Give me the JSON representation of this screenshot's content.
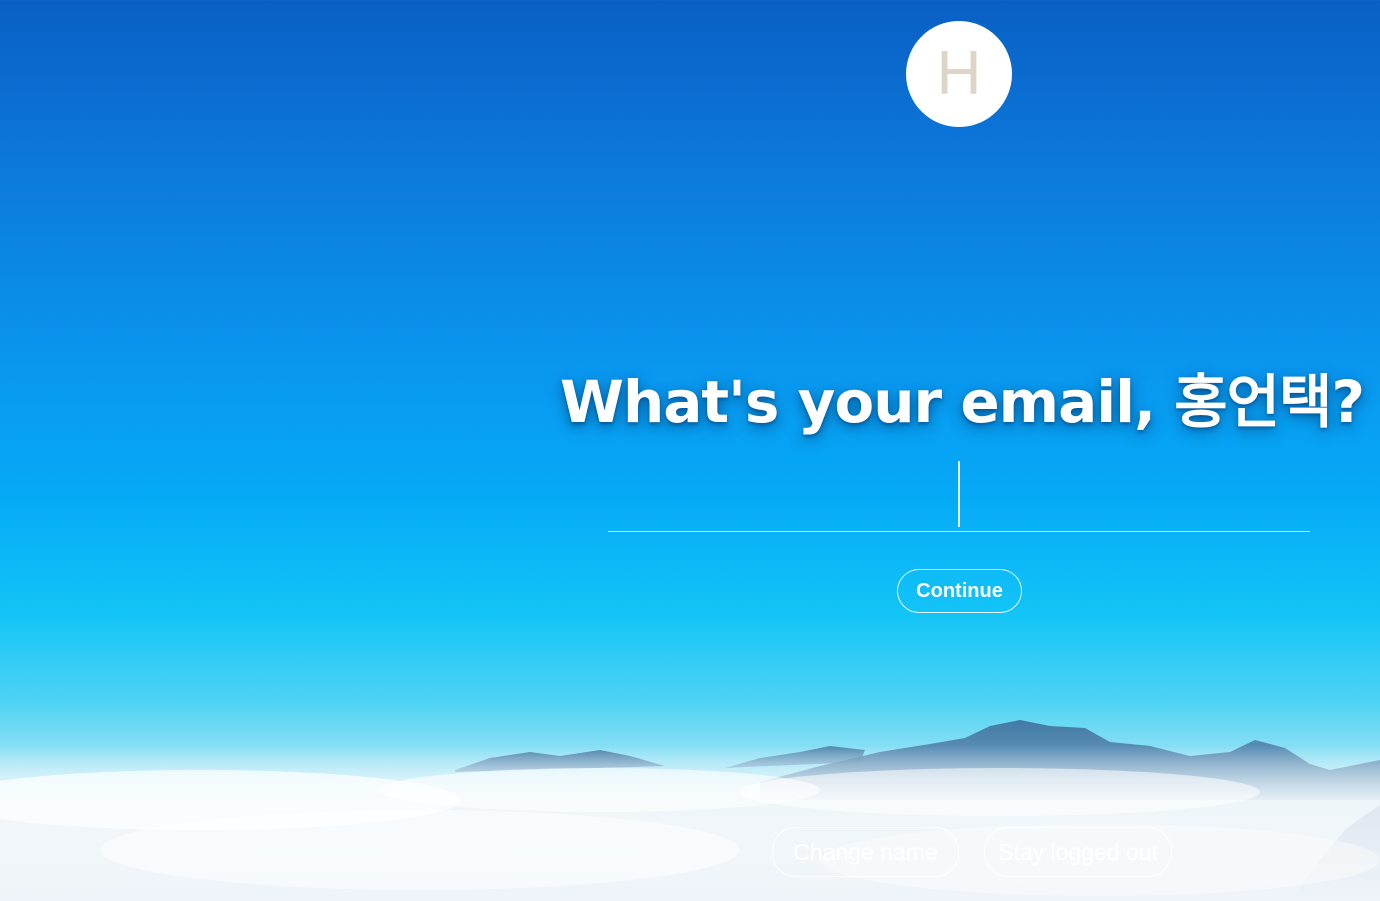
{
  "avatar": {
    "initial": "H"
  },
  "prompt": {
    "title": "What's your email, 홍언택?"
  },
  "email_input": {
    "value": "",
    "placeholder": ""
  },
  "buttons": {
    "continue": "Continue",
    "change_name": "Change name",
    "stay_logged_out": "Stay logged out"
  },
  "colors": {
    "sky_top": "#0a5fc4",
    "sky_mid": "#05aaf6",
    "cloud": "#f1f6fa",
    "avatar_bg": "#ffffff",
    "avatar_letter": "#ddd6c6"
  }
}
